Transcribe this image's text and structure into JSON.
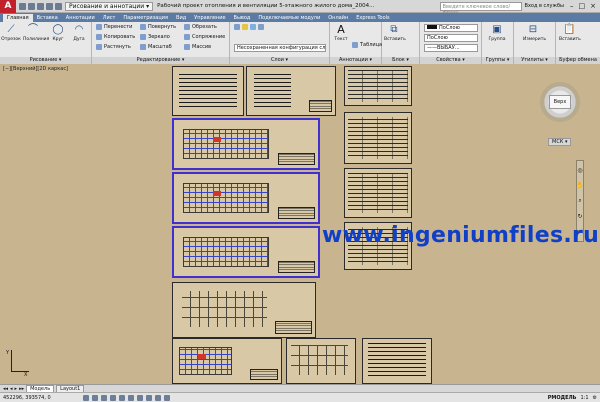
{
  "app": {
    "logo": "A",
    "workspace": "Рисование и аннотации",
    "title": "Рабочий проект отопления и вентиляции 5-этажного жилого дома_2004...",
    "search_placeholder": "Введите ключевое слово/фразу",
    "login": "Вход в службы",
    "win_min": "–",
    "win_max": "□",
    "win_close": "×"
  },
  "tabs": [
    "Главная",
    "Вставка",
    "Аннотации",
    "Лист",
    "Параметризация",
    "Вид",
    "Управление",
    "Вывод",
    "Подключаемые модули",
    "Онлайн",
    "Express Tools"
  ],
  "ribbon": {
    "draw": {
      "label": "Рисование ▾",
      "btn_line": "Отрезок",
      "btn_polyline": "Полилиния",
      "btn_circle": "Круг",
      "btn_arc": "Дуга"
    },
    "modify": {
      "label": "Редактирование ▾",
      "move": "Перенести",
      "copy": "Копировать",
      "stretch": "Растянуть",
      "rotate": "Повернуть",
      "mirror": "Зеркало",
      "scale": "Масштаб",
      "trim": "Обрезать",
      "fillet": "Сопряжение",
      "array": "Массив"
    },
    "layers": {
      "label": "Слои ▾",
      "layer_state": "Несохраненная конфигурация слоя"
    },
    "annotation": {
      "label": "Аннотации ▾",
      "text": "Текст",
      "table": "Таблица"
    },
    "block": {
      "label": "Блок ▾",
      "insert": "Вставить"
    },
    "properties": {
      "label": "Свойства ▾",
      "color": "ПоСлою",
      "linetype": "ПоСлою",
      "lineweight": "——ВЫБАУ..."
    },
    "groups": {
      "label": "Группы ▾",
      "group": "Группа"
    },
    "utilities": {
      "label": "Утилиты ▾",
      "measure": "Измерить"
    },
    "clipboard": {
      "label": "Буфер обмена",
      "paste": "Вставить"
    }
  },
  "viewport": {
    "label": "[−][Верхний][2D каркас]",
    "viewcube": "Верх",
    "wcs": "МСК ▾",
    "watermark": "www.ingeniumfiles.ru",
    "ucs_y": "Y",
    "ucs_x": "X"
  },
  "layout_tabs": [
    "Модель",
    "Layout1"
  ],
  "status": {
    "coords": "452296, 393574, 0",
    "model": "PMОДЕЛЬ",
    "scale": "1:1"
  }
}
